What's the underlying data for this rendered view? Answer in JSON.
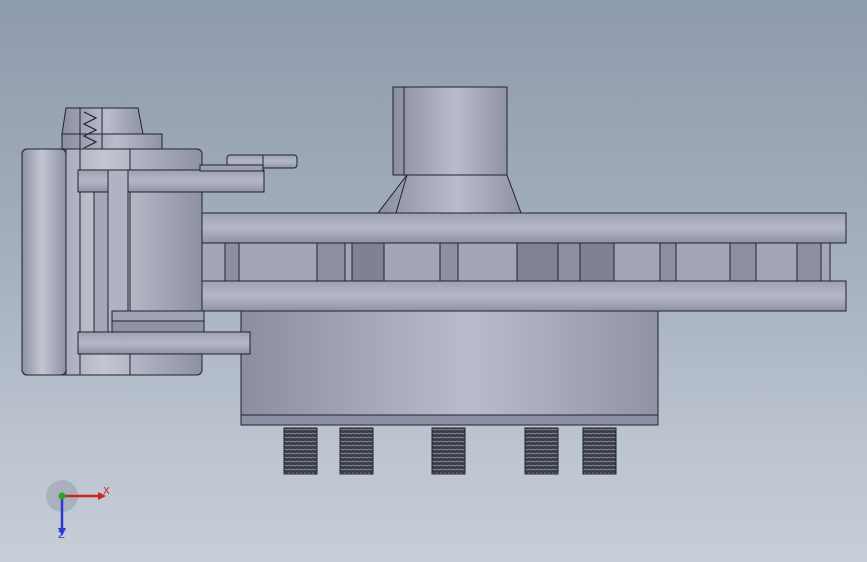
{
  "viewport": {
    "background_top": "#8e9bac",
    "background_bottom": "#c6ced8"
  },
  "model": {
    "description_icon": "brake-caliper-disc-assembly",
    "body_color": "#a8acbb",
    "edge_color": "#1f2230",
    "bolt_count": 5
  },
  "triad": {
    "x_label": "X",
    "z_label": "Z",
    "x_color": "#d0231c",
    "y_color": "#2aa32a",
    "z_color": "#2a3ad0"
  }
}
